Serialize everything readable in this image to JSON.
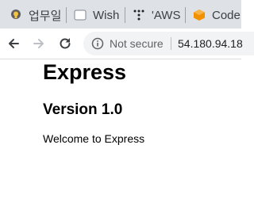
{
  "tabs": [
    {
      "label": "업무일",
      "icon": "lightbulb-icon"
    },
    {
      "label": "Wish",
      "icon": "document-icon"
    },
    {
      "label": "'AWS",
      "icon": "dots-icon"
    },
    {
      "label": "Code",
      "icon": "aws-cube-icon"
    }
  ],
  "toolbar": {
    "security_label": "Not secure",
    "url": "54.180.94.18"
  },
  "page": {
    "heading": "Express",
    "subheading": "Version 1.0",
    "text": "Welcome to Express"
  },
  "colors": {
    "tab_bar": "#dee1e6",
    "omnibox": "#f1f3f4",
    "aws_orange": "#f29100"
  }
}
